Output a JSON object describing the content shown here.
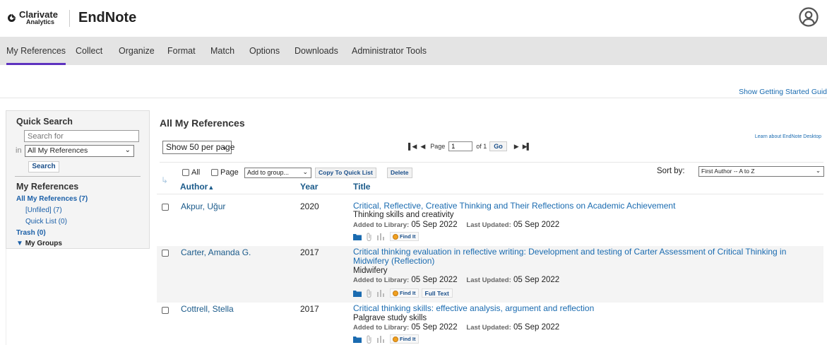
{
  "header": {
    "brand_line1": "Clarivate",
    "brand_line2": "Analytics",
    "app_name": "EndNote"
  },
  "nav": {
    "items": [
      "My References",
      "Collect",
      "Organize",
      "Format",
      "Match",
      "Options",
      "Downloads",
      "Administrator Tools"
    ],
    "active": "My References"
  },
  "getting_started": "Show Getting Started Guid",
  "sidebar": {
    "quick_search_title": "Quick Search",
    "search_placeholder": "Search for",
    "in_label": "in",
    "scope_value": "All My References",
    "search_button": "Search",
    "my_references_title": "My References",
    "links": {
      "all": "All My References (7)",
      "unfiled": "[Unfiled] (7)",
      "quick_list": "Quick List (0)",
      "trash": "Trash (0)",
      "my_groups": "My Groups"
    }
  },
  "main": {
    "title": "All My References",
    "learn_link": "Learn about EndNote Desktop",
    "per_page": "Show 50 per page",
    "pager": {
      "page_label": "Page",
      "page_value": "1",
      "of_label": "of 1",
      "go": "Go"
    },
    "toolbar": {
      "all_label": "All",
      "page_label": "Page",
      "add_to_group": "Add to group...",
      "copy_quick_list": "Copy To Quick List",
      "delete": "Delete",
      "sort_by_label": "Sort by:",
      "sort_by_value": "First Author -- A to Z"
    },
    "columns": {
      "author": "Author",
      "year": "Year",
      "title": "Title"
    },
    "meta_labels": {
      "added": "Added to Library:",
      "updated": "Last Updated:"
    },
    "find_it": "Find It",
    "full_text": "Full Text",
    "references": [
      {
        "author": "Akpur, Uğur",
        "year": "2020",
        "title": "Critical, Reflective, Creative Thinking and Their Reflections on Academic Achievement",
        "publication": "Thinking skills and creativity",
        "added": "05 Sep 2022",
        "updated": "05 Sep 2022"
      },
      {
        "author": "Carter, Amanda G.",
        "year": "2017",
        "title": "Critical thinking evaluation in reflective writing: Development and testing of Carter Assessment of Critical Thinking in Midwifery (Reflection)",
        "publication": "Midwifery",
        "added": "05 Sep 2022",
        "updated": "05 Sep 2022"
      },
      {
        "author": "Cottrell, Stella",
        "year": "2017",
        "title": "Critical thinking skills: effective analysis, argument and reflection",
        "publication": "Palgrave study skills",
        "added": "05 Sep 2022",
        "updated": "05 Sep 2022"
      }
    ]
  }
}
